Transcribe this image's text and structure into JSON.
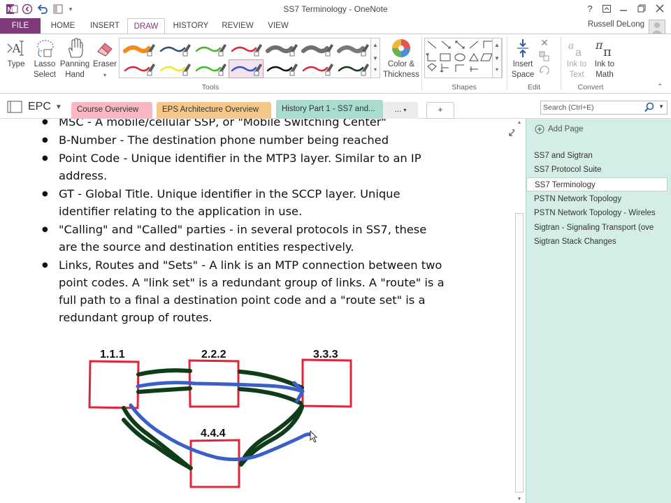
{
  "window": {
    "title": "SS7 Terminology - OneNote",
    "help": "?",
    "app_badge": "N"
  },
  "ribbon_tabs": [
    "FILE",
    "HOME",
    "INSERT",
    "DRAW",
    "HISTORY",
    "REVIEW",
    "VIEW"
  ],
  "active_tab": "DRAW",
  "user": "Russell DeLong",
  "ribbon": {
    "type_label": "Type",
    "lasso_label": [
      "Lasso",
      "Select"
    ],
    "panning_label": [
      "Panning",
      "Hand"
    ],
    "eraser_label": "Eraser",
    "color_thickness_label": [
      "Color &",
      "Thickness"
    ],
    "insert_space_label": [
      "Insert",
      "Space"
    ],
    "ink_to_text_label": [
      "Ink to",
      "Text"
    ],
    "ink_to_math_label": [
      "Ink to",
      "Math"
    ],
    "groups": {
      "tools": "Tools",
      "shapes": "Shapes",
      "edit": "Edit",
      "convert": "Convert"
    },
    "pen_colors": [
      [
        "#f28a1e",
        "#2f4f6f",
        "#4caf2f",
        "#e0253b",
        "#6f6f6f",
        "#6f6f6f",
        "#7a7a7a"
      ],
      [
        "#e0253b",
        "#f4e81a",
        "#37c51c",
        "#2f55c8",
        "#111111",
        "#e0253b",
        "#0f3d1a"
      ]
    ]
  },
  "notebook": "EPC",
  "section_tabs": [
    {
      "label": "Course Overview",
      "color": "#f7b8c3"
    },
    {
      "label": "EPS Architecture Overview",
      "color": "#f5c889"
    },
    {
      "label": "History Part 1 - SS7 and...",
      "color": "#a7dccf"
    },
    {
      "label": "...",
      "color": "#ececec"
    },
    {
      "label": "+",
      "color": "#ffffff"
    }
  ],
  "search": {
    "placeholder": "Search (Ctrl+E)"
  },
  "notes": [
    "MSC - A mobile/cellular SSP, or \"Mobile Switching Center\"",
    "B-Number - The destination phone number being reached",
    "Point Code - Unique identifier in the MTP3 layer. Similar to an IP address.",
    "GT - Global Title. Unique identifier in the SCCP layer. Unique identifier relating to the application in use.",
    "\"Calling\" and \"Called\" parties - in several protocols in SS7, these are the source and destination entities respectively.",
    "Links, Routes and \"Sets\" - A link is an MTP connection between two point codes. A \"link set\" is a redundant group of links. A \"route\" is a full path to a final a destination point code and a \"route set\" is a redundant group of routes."
  ],
  "diagram": {
    "nodes": [
      "1.1.1",
      "2.2.2",
      "3.3.3",
      "4.4.4"
    ],
    "colors": {
      "box": "#e0253b",
      "link": "#0f3d1a",
      "route": "#3a5fc8"
    }
  },
  "pages": {
    "add_label": "Add Page",
    "items": [
      "SS7 and Sigtran",
      "SS7 Protocol Suite",
      "SS7 Terminology",
      "PSTN Network Topology",
      "PSTN Network Topology - Wireles",
      "Sigtran - Signaling Transport (ove",
      "Sigtran Stack Changes"
    ],
    "selected_index": 2
  }
}
